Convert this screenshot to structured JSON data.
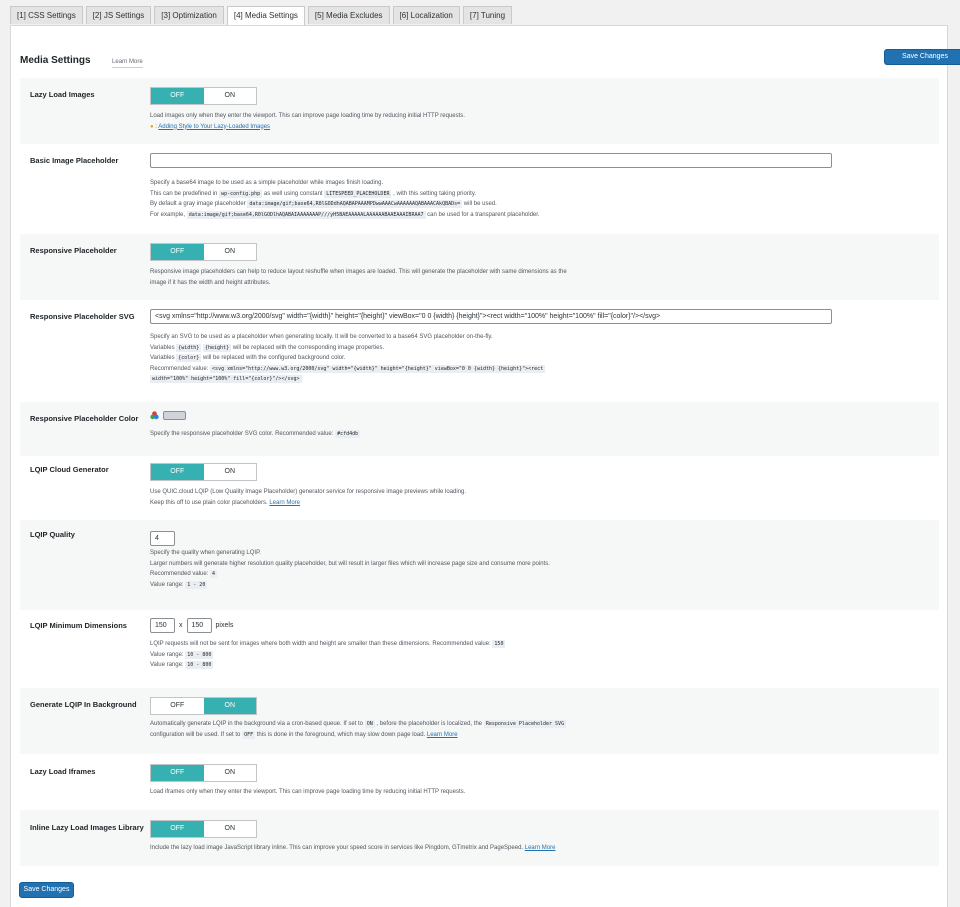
{
  "tabs": [
    "[1] CSS Settings",
    "[2] JS Settings",
    "[3] Optimization",
    "[4] Media Settings",
    "[5] Media Excludes",
    "[6] Localization",
    "[7] Tuning"
  ],
  "header": {
    "title": "Media Settings",
    "learn_more": "Learn More",
    "save": "Save Changes"
  },
  "toggle": {
    "off": "OFF",
    "on": "ON"
  },
  "lazy_load_images": {
    "label": "Lazy Load Images",
    "state": "OFF",
    "desc": "Load images only when they enter the viewport. This can improve page loading time by reducing initial HTTP requests.",
    "tip_link": "Adding Style to Your Lazy-Loaded Images"
  },
  "basic_placeholder": {
    "label": "Basic Image Placeholder",
    "value": "",
    "l1": "Specify a base64 image to be used as a simple placeholder while images finish loading.",
    "l2a": "This can be predefined in",
    "l2code1": "wp-config.php",
    "l2b": "as well using constant",
    "l2code2": "LITESPEED_PLACEHOLDER",
    "l2c": ", with this setting taking priority.",
    "l3a": "By default a gray image placeholder",
    "l3code": "data:image/gif;base64,R0lGODdhAQABAPAAAMPDwwAAACwAAAAAAQABAAACAkQBADs=",
    "l3b": "will be used.",
    "l4a": "For example,",
    "l4code": "data:image/gif;base64,R0lGODlhAQABAIAAAAAAAP///yH5BAEAAAAALAAAAAABAAEAAAIBRAA7",
    "l4b": "can be used for a transparent placeholder."
  },
  "responsive_placeholder": {
    "label": "Responsive Placeholder",
    "state": "OFF",
    "l1": "Responsive image placeholders can help to reduce layout reshuffle when images are loaded. This will generate the placeholder with same dimensions as the",
    "l2": "image if it has the width and height attributes."
  },
  "responsive_svg": {
    "label": "Responsive Placeholder SVG",
    "value": "<svg xmlns=\"http://www.w3.org/2000/svg\" width=\"{width}\" height=\"{height}\" viewBox=\"0 0 {width} {height}\"><rect width=\"100%\" height=\"100%\" fill=\"{color}\"/></svg>",
    "l1": "Specify an SVG to be used as a placeholder when generating locally. It will be converted to a base64 SVG placeholder on-the-fly.",
    "l2a": "Variables",
    "l2code1": "{width}",
    "l2code2": "{height}",
    "l2b": "will be replaced with the corresponding image properties.",
    "l3a": "Variables",
    "l3code": "{color}",
    "l3b": "will be replaced with the configured background color.",
    "l4a": "Recommended value:",
    "l4code1": "<svg xmlns=\"http://www.w3.org/2000/svg\" width=\"{width}\" height=\"{height}\" viewBox=\"0 0 {width} {height}\"><rect",
    "l4code2": "width=\"100%\" height=\"100%\" fill=\"{color}\"/></svg>"
  },
  "placeholder_color": {
    "label": "Responsive Placeholder Color",
    "swatch": "#cfd4db",
    "desc": "Specify the responsive placeholder SVG color. Recommended value:",
    "code": "#cfd4db"
  },
  "lqip_cloud": {
    "label": "LQIP Cloud Generator",
    "state": "OFF",
    "l1": "Use QUIC.cloud LQIP (Low Quality Image Placeholder) generator service for responsive image previews while loading.",
    "l2": "Keep this off to use plain color placeholders.",
    "link": "Learn More"
  },
  "lqip_quality": {
    "label": "LQIP Quality",
    "value": "4",
    "l1": "Specify the quality when generating LQIP.",
    "l2": "Larger numbers will generate higher resolution quality placeholder, but will result in larger files which will increase page size and consume more points.",
    "l3": "Recommended value:",
    "l3code": "4",
    "l4": "Value range:",
    "l4code": "1 - 20"
  },
  "lqip_min": {
    "label": "LQIP Minimum Dimensions",
    "width": "150",
    "x": "x",
    "height": "150",
    "unit": "pixels",
    "l1": "LQIP requests will not be sent for images where both width and height are smaller than these dimensions. Recommended value:",
    "l1code": "150",
    "l2": "Value range:",
    "l2code": "10 - 800",
    "l3": "Value range:",
    "l3code": "10 - 800"
  },
  "lqip_bg": {
    "label": "Generate LQIP In Background",
    "state": "ON",
    "l1a": "Automatically generate LQIP in the background via a cron-based queue. If set to",
    "l1code1": "ON",
    "l1b": ", before the placeholder is localized, the",
    "l1code2": "Responsive Placeholder SVG",
    "l2a": "configuration will be used. If set to",
    "l2code": "OFF",
    "l2b": "this is done in the foreground, which may slow down page load.",
    "link": "Learn More"
  },
  "lazy_iframes": {
    "label": "Lazy Load Iframes",
    "state": "OFF",
    "desc": "Load iframes only when they enter the viewport. This can improve page loading time by reducing initial HTTP requests."
  },
  "inline_lib": {
    "label": "Inline Lazy Load Images Library",
    "state": "OFF",
    "desc": "Include the lazy load image JavaScript library inline. This can improve your speed score in services like Pingdom, GTmetrix and PageSpeed.",
    "link": "Learn More"
  }
}
